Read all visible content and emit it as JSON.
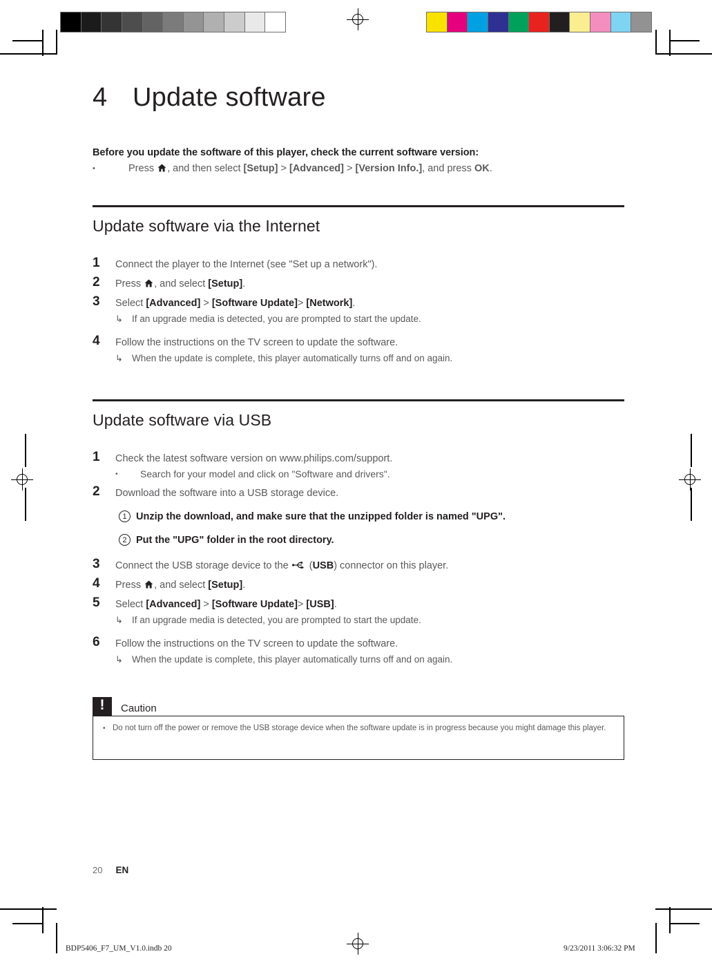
{
  "document": {
    "chapter_number": "4",
    "chapter_title": "Update software",
    "page_number": "20",
    "language_code": "EN"
  },
  "calibration": {
    "grey_bar": [
      "#000000",
      "#1b1b1b",
      "#343434",
      "#4d4d4d",
      "#636363",
      "#7b7b7b",
      "#949494",
      "#b0b0b0",
      "#cccccc",
      "#e9e9e9",
      "#ffffff"
    ],
    "color_bar": [
      "#fae200",
      "#e5007d",
      "#00a0e3",
      "#2e3191",
      "#00a15a",
      "#e8221d",
      "#231f20",
      "#fbee91",
      "#f48ebf",
      "#7fd4f4",
      "#929292"
    ]
  },
  "intro": {
    "text": "Before you update the software of this player, check the current software version:",
    "bullet": {
      "marker": "•",
      "prefix": "Press ",
      "icon": "home-icon",
      "mid1": ", and then select ",
      "key1": "[Setup]",
      "sep1": " > ",
      "key2": "[Advanced]",
      "sep2": " > ",
      "key3": "[Version Info.]",
      "mid2": ", and press ",
      "key4": "OK",
      "suffix": "."
    }
  },
  "sections": [
    {
      "heading": "Update software via the Internet",
      "steps": [
        {
          "num": "1",
          "text": "Connect the player to the Internet (see \"Set up a network\")."
        },
        {
          "num": "2",
          "prefix": "Press ",
          "icon": "home-icon",
          "mid": ", and select ",
          "key1": "[Setup]",
          "suffix": "."
        },
        {
          "num": "3",
          "prefix": "Select ",
          "key1": "[Advanced]",
          "sep1": " > ",
          "key2": "[Software Update]",
          "sep2": "> ",
          "key3": "[Network]",
          "suffix": ".",
          "note": {
            "arrow": "↳",
            "text": "If an upgrade media is detected, you are prompted to start the update."
          }
        },
        {
          "num": "4",
          "text": "Follow the instructions on the TV screen to update the software.",
          "note": {
            "arrow": "↳",
            "text": "When the update is complete, this player automatically turns off and on again."
          }
        }
      ]
    },
    {
      "heading": "Update software via USB",
      "steps": [
        {
          "num": "1",
          "text": "Check the latest software version on www.philips.com/support.",
          "sub_bullet": {
            "marker": "•",
            "text": "Search for your model and click on \"Software and drivers\"."
          }
        },
        {
          "num": "2",
          "text": "Download the software into a USB storage device.",
          "circled": [
            {
              "num": "1",
              "text": "Unzip the download, and make sure that the unzipped folder is named \"UPG\"."
            },
            {
              "num": "2",
              "text": "Put the \"UPG\" folder in the root directory."
            }
          ]
        },
        {
          "num": "3",
          "prefix": "Connect the USB storage device to the ",
          "icon": "usb-icon",
          "mid": " (",
          "key1": "USB",
          "suffix": ") connector on this player."
        },
        {
          "num": "4",
          "prefix": "Press ",
          "icon": "home-icon",
          "mid": ", and select ",
          "key1": "[Setup]",
          "suffix": "."
        },
        {
          "num": "5",
          "prefix": "Select ",
          "key1": "[Advanced]",
          "sep1": " > ",
          "key2": "[Software Update]",
          "sep2": "> ",
          "key3": "[USB]",
          "suffix": ".",
          "note": {
            "arrow": "↳",
            "text": "If an upgrade media is detected, you are prompted to start the update."
          }
        },
        {
          "num": "6",
          "text": "Follow the instructions on the TV screen to update the software.",
          "note": {
            "arrow": "↳",
            "text": "When the update is complete, this player automatically turns off and on again."
          }
        }
      ]
    }
  ],
  "caution": {
    "icon_glyph": "!",
    "label": "Caution",
    "bullet_marker": "•",
    "text": "Do not turn off the power or remove the USB storage device when the software update is in progress because you might damage this player."
  },
  "print_slug": {
    "file_name": "BDP5406_F7_UM_V1.0.indb   20",
    "timestamp": "9/23/2011   3:06:32 PM"
  }
}
